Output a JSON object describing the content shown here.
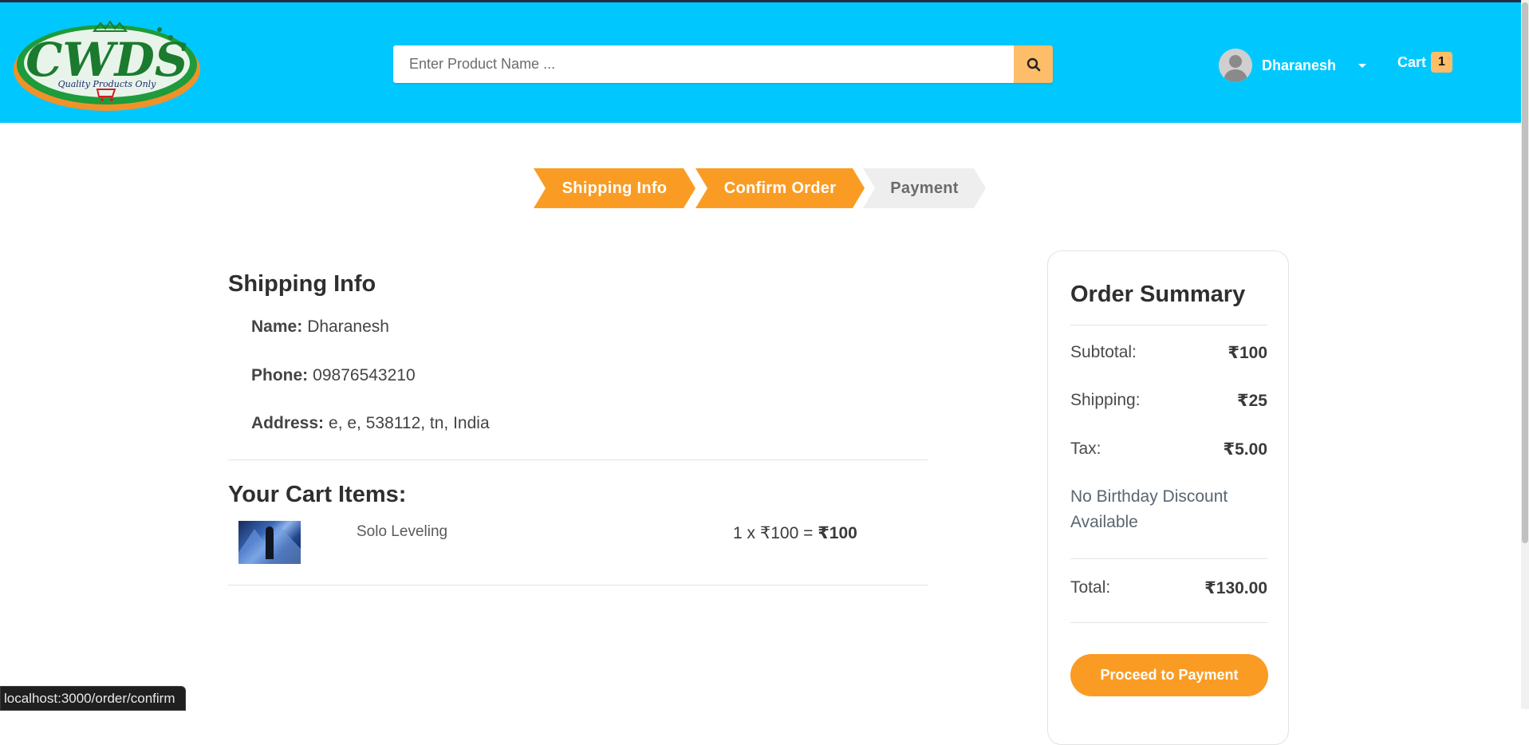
{
  "header": {
    "logo_text": "CWDS",
    "logo_tagline": "Quality Products Only",
    "search_placeholder": "Enter Product Name ...",
    "user_name": "Dharanesh",
    "cart_label": "Cart",
    "cart_count": "1"
  },
  "steps": [
    {
      "label": "Shipping Info",
      "state": "done"
    },
    {
      "label": "Confirm Order",
      "state": "active"
    },
    {
      "label": "Payment",
      "state": "pending"
    }
  ],
  "shipping": {
    "title": "Shipping Info",
    "name_label": "Name:",
    "name_value": "Dharanesh",
    "phone_label": "Phone:",
    "phone_value": "09876543210",
    "address_label": "Address:",
    "address_value": "e, e, 538112, tn, India"
  },
  "cart": {
    "title": "Your Cart Items:",
    "items": [
      {
        "name": "Solo Leveling",
        "qty_price": "1 x ₹100 = ",
        "line_total": "₹100"
      }
    ]
  },
  "summary": {
    "title": "Order Summary",
    "subtotal_label": "Subtotal:",
    "subtotal_value": "₹100",
    "shipping_label": "Shipping:",
    "shipping_value": "₹25",
    "tax_label": "Tax:",
    "tax_value": "₹5.00",
    "discount_note": "No Birthday Discount Available",
    "total_label": "Total:",
    "total_value": "₹130.00",
    "proceed_label": "Proceed to Payment"
  },
  "status_url": "localhost:3000/order/confirm",
  "colors": {
    "navbar": "#00c8ff",
    "accent": "#fa9c23",
    "search_button": "#febd69"
  }
}
